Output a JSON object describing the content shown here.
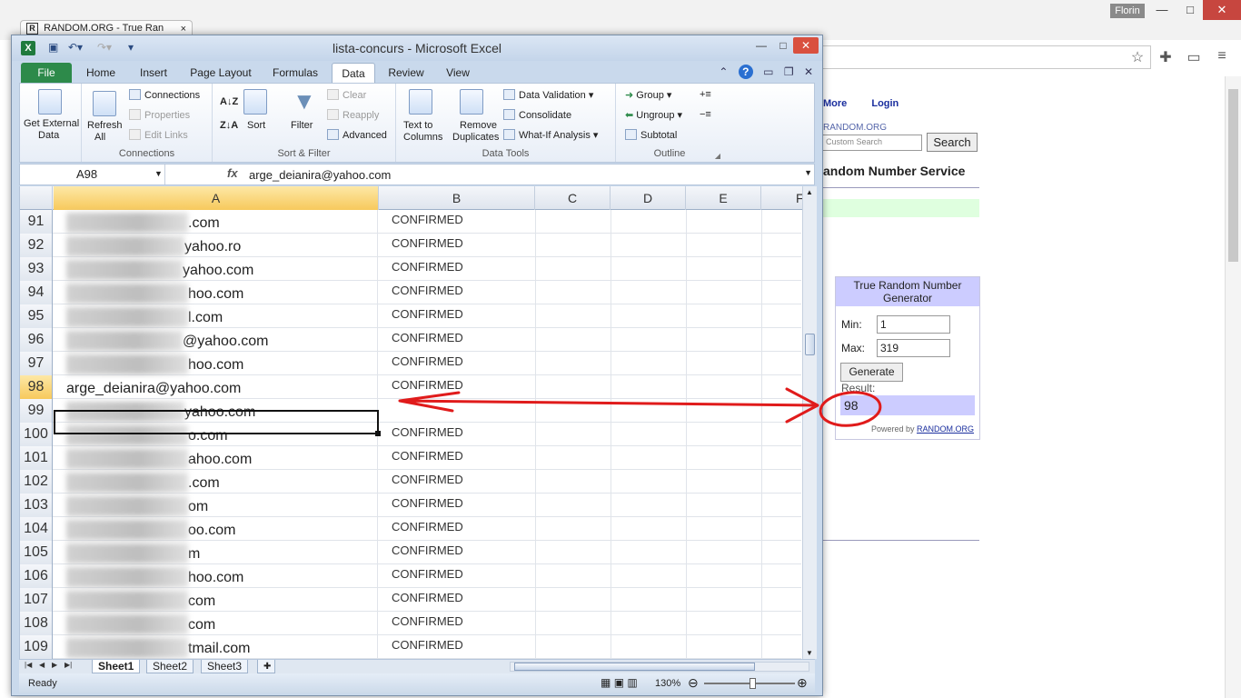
{
  "browser": {
    "tab_title": "RANDOM.ORG - True Ran",
    "tab_close": "×",
    "favicon": "R",
    "user": "Florin",
    "window_min": "—",
    "window_max": "□",
    "window_close": "✕"
  },
  "random_org": {
    "nav_more": "More",
    "nav_login": "Login",
    "brand": "RANDOM.ORG",
    "search_placeholder": "Custom Search",
    "search_button": "Search",
    "title": "andom Number Service",
    "widget_title": "True Random Number Generator",
    "min_label": "Min:",
    "min_value": "1",
    "max_label": "Max:",
    "max_value": "319",
    "generate_button": "Generate",
    "result_label": "Result:",
    "result_value": "98",
    "powered_prefix": "Powered by",
    "powered_link": "RANDOM.ORG"
  },
  "excel": {
    "title": "lista-concurs - Microsoft Excel",
    "tabs": [
      "File",
      "Home",
      "Insert",
      "Page Layout",
      "Formulas",
      "Data",
      "Review",
      "View"
    ],
    "ribbon": {
      "get_external": "Get External",
      "get_external_2": "Data",
      "refresh": "Refresh",
      "refresh_2": "All",
      "connections": "Connections",
      "properties": "Properties",
      "edit_links": "Edit Links",
      "connections_group": "Connections",
      "sort": "Sort",
      "filter": "Filter",
      "clear": "Clear",
      "reapply": "Reapply",
      "advanced": "Advanced",
      "sort_filter_group": "Sort & Filter",
      "text_to": "Text to",
      "columns": "Columns",
      "remove": "Remove",
      "duplicates": "Duplicates",
      "data_validation": "Data Validation",
      "consolidate": "Consolidate",
      "what_if": "What-If Analysis",
      "data_tools_group": "Data Tools",
      "group": "Group",
      "ungroup": "Ungroup",
      "subtotal": "Subtotal",
      "outline_group": "Outline"
    },
    "name_box": "A98",
    "fx": "fx",
    "formula": "arge_deianira@yahoo.com",
    "columns": [
      "A",
      "B",
      "C",
      "D",
      "E",
      "F"
    ],
    "rows": [
      {
        "num": "91",
        "a": ".com",
        "b": "CONFIRMED",
        "blur": 134
      },
      {
        "num": "92",
        "a": "yahoo.ro",
        "b": "CONFIRMED",
        "blur": 130
      },
      {
        "num": "93",
        "a": "yahoo.com",
        "b": "CONFIRMED",
        "blur": 128
      },
      {
        "num": "94",
        "a": "hoo.com",
        "b": "CONFIRMED",
        "blur": 134
      },
      {
        "num": "95",
        "a": "l.com",
        "b": "CONFIRMED",
        "blur": 134
      },
      {
        "num": "96",
        "a": "@yahoo.com",
        "b": "CONFIRMED",
        "blur": 128
      },
      {
        "num": "97",
        "a": "hoo.com",
        "b": "CONFIRMED",
        "blur": 134
      },
      {
        "num": "98",
        "a": "arge_deianira@yahoo.com",
        "b": "CONFIRMED",
        "blur": 0
      },
      {
        "num": "99",
        "a": "yahoo.com",
        "b": "",
        "blur": 130
      },
      {
        "num": "100",
        "a": "o.com",
        "b": "CONFIRMED",
        "blur": 134
      },
      {
        "num": "101",
        "a": "ahoo.com",
        "b": "CONFIRMED",
        "blur": 134
      },
      {
        "num": "102",
        "a": ".com",
        "b": "CONFIRMED",
        "blur": 134
      },
      {
        "num": "103",
        "a": "om",
        "b": "CONFIRMED",
        "blur": 134
      },
      {
        "num": "104",
        "a": "oo.com",
        "b": "CONFIRMED",
        "blur": 134
      },
      {
        "num": "105",
        "a": "m",
        "b": "CONFIRMED",
        "blur": 134
      },
      {
        "num": "106",
        "a": "hoo.com",
        "b": "CONFIRMED",
        "blur": 134
      },
      {
        "num": "107",
        "a": "com",
        "b": "CONFIRMED",
        "blur": 134
      },
      {
        "num": "108",
        "a": "com",
        "b": "CONFIRMED",
        "blur": 134
      },
      {
        "num": "109",
        "a": "tmail.com",
        "b": "CONFIRMED",
        "blur": 134
      }
    ],
    "sheets": [
      "Sheet1",
      "Sheet2",
      "Sheet3"
    ],
    "status_ready": "Ready",
    "zoom": "130%"
  },
  "annotation_color": "#e01b1b"
}
